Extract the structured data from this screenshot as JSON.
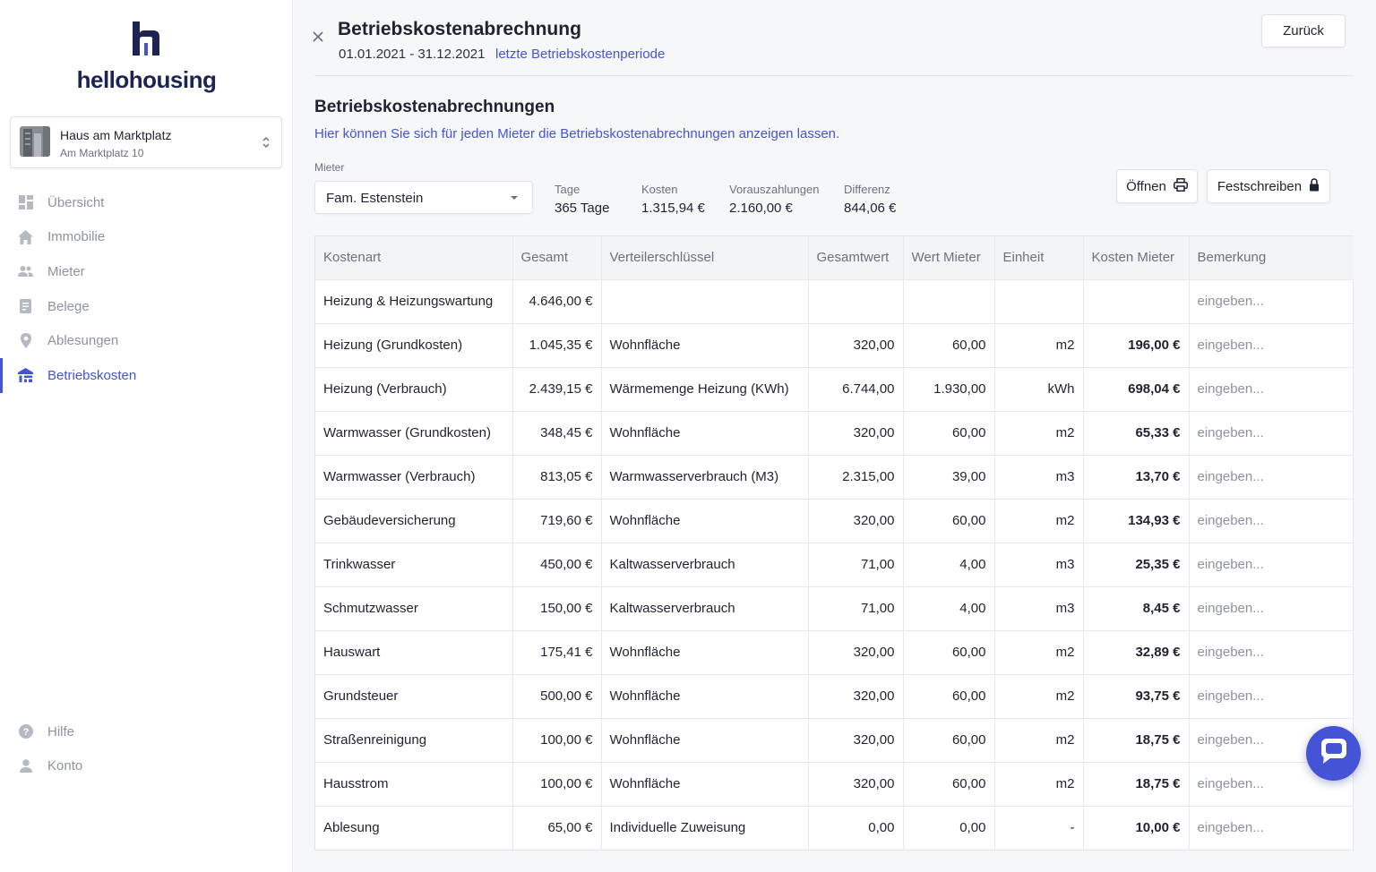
{
  "brand": {
    "name": "hellohousing",
    "accent": "#4553d6",
    "logo_color": "#1d2453"
  },
  "property": {
    "name": "Haus am Marktplatz",
    "address": "Am Marktplatz 10"
  },
  "nav": [
    {
      "label": "Übersicht",
      "icon": "dashboard-icon"
    },
    {
      "label": "Immobilie",
      "icon": "home-icon"
    },
    {
      "label": "Mieter",
      "icon": "people-icon"
    },
    {
      "label": "Belege",
      "icon": "receipt-icon"
    },
    {
      "label": "Ablesungen",
      "icon": "meter-icon"
    },
    {
      "label": "Betriebskosten",
      "icon": "utility-icon",
      "active": true
    }
  ],
  "nav_bottom": [
    {
      "label": "Hilfe",
      "icon": "help-icon"
    },
    {
      "label": "Konto",
      "icon": "account-icon"
    }
  ],
  "header": {
    "title": "Betriebskostenabrechnung",
    "period": "01.01.2021 - 31.12.2021",
    "period_link": "letzte Betriebskostenperiode",
    "back_label": "Zurück"
  },
  "section": {
    "title": "Betriebskostenabrechnungen",
    "subtitle": "Hier können Sie sich für jeden Mieter die Betriebskostenabrechnungen anzeigen lassen."
  },
  "tenant": {
    "label": "Mieter",
    "selected": "Fam. Estenstein"
  },
  "stats": {
    "tage": {
      "label": "Tage",
      "value": "365 Tage"
    },
    "kosten": {
      "label": "Kosten",
      "value": "1.315,94 €"
    },
    "voraus": {
      "label": "Vorauszahlungen",
      "value": "2.160,00 €"
    },
    "diff": {
      "label": "Differenz",
      "value": "844,06 €"
    }
  },
  "actions": {
    "open_label": "Öffnen",
    "finalize_label": "Festschreiben"
  },
  "table": {
    "columns": [
      "Kostenart",
      "Gesamt",
      "Verteilerschlüssel",
      "Gesamtwert",
      "Wert Mieter",
      "Einheit",
      "Kosten Mieter",
      "Bemerkung"
    ],
    "rows": [
      [
        "Heizung & Heizungswartung",
        "4.646,00 €",
        "",
        "",
        "",
        "",
        "",
        "eingeben..."
      ],
      [
        "Heizung (Grundkosten)",
        "1.045,35 €",
        "Wohnfläche",
        "320,00",
        "60,00",
        "m2",
        "196,00 €",
        "eingeben..."
      ],
      [
        "Heizung (Verbrauch)",
        "2.439,15 €",
        "Wärmemenge Heizung (KWh)",
        "6.744,00",
        "1.930,00",
        "kWh",
        "698,04 €",
        "eingeben..."
      ],
      [
        "Warmwasser (Grundkosten)",
        "348,45 €",
        "Wohnfläche",
        "320,00",
        "60,00",
        "m2",
        "65,33 €",
        "eingeben..."
      ],
      [
        "Warmwasser (Verbrauch)",
        "813,05 €",
        "Warmwasserverbrauch (M3)",
        "2.315,00",
        "39,00",
        "m3",
        "13,70 €",
        "eingeben..."
      ],
      [
        "Gebäudeversicherung",
        "719,60 €",
        "Wohnfläche",
        "320,00",
        "60,00",
        "m2",
        "134,93 €",
        "eingeben..."
      ],
      [
        "Trinkwasser",
        "450,00 €",
        "Kaltwasserverbrauch",
        "71,00",
        "4,00",
        "m3",
        "25,35 €",
        "eingeben..."
      ],
      [
        "Schmutzwasser",
        "150,00 €",
        "Kaltwasserverbrauch",
        "71,00",
        "4,00",
        "m3",
        "8,45 €",
        "eingeben..."
      ],
      [
        "Hauswart",
        "175,41 €",
        "Wohnfläche",
        "320,00",
        "60,00",
        "m2",
        "32,89 €",
        "eingeben..."
      ],
      [
        "Grundsteuer",
        "500,00 €",
        "Wohnfläche",
        "320,00",
        "60,00",
        "m2",
        "93,75 €",
        "eingeben..."
      ],
      [
        "Straßenreinigung",
        "100,00 €",
        "Wohnfläche",
        "320,00",
        "60,00",
        "m2",
        "18,75 €",
        "eingeben..."
      ],
      [
        "Hausstrom",
        "100,00 €",
        "Wohnfläche",
        "320,00",
        "60,00",
        "m2",
        "18,75 €",
        "eingeben..."
      ],
      [
        "Ablesung",
        "65,00 €",
        "Individuelle Zuweisung",
        "0,00",
        "0,00",
        "-",
        "10,00 €",
        "eingeben..."
      ]
    ]
  }
}
